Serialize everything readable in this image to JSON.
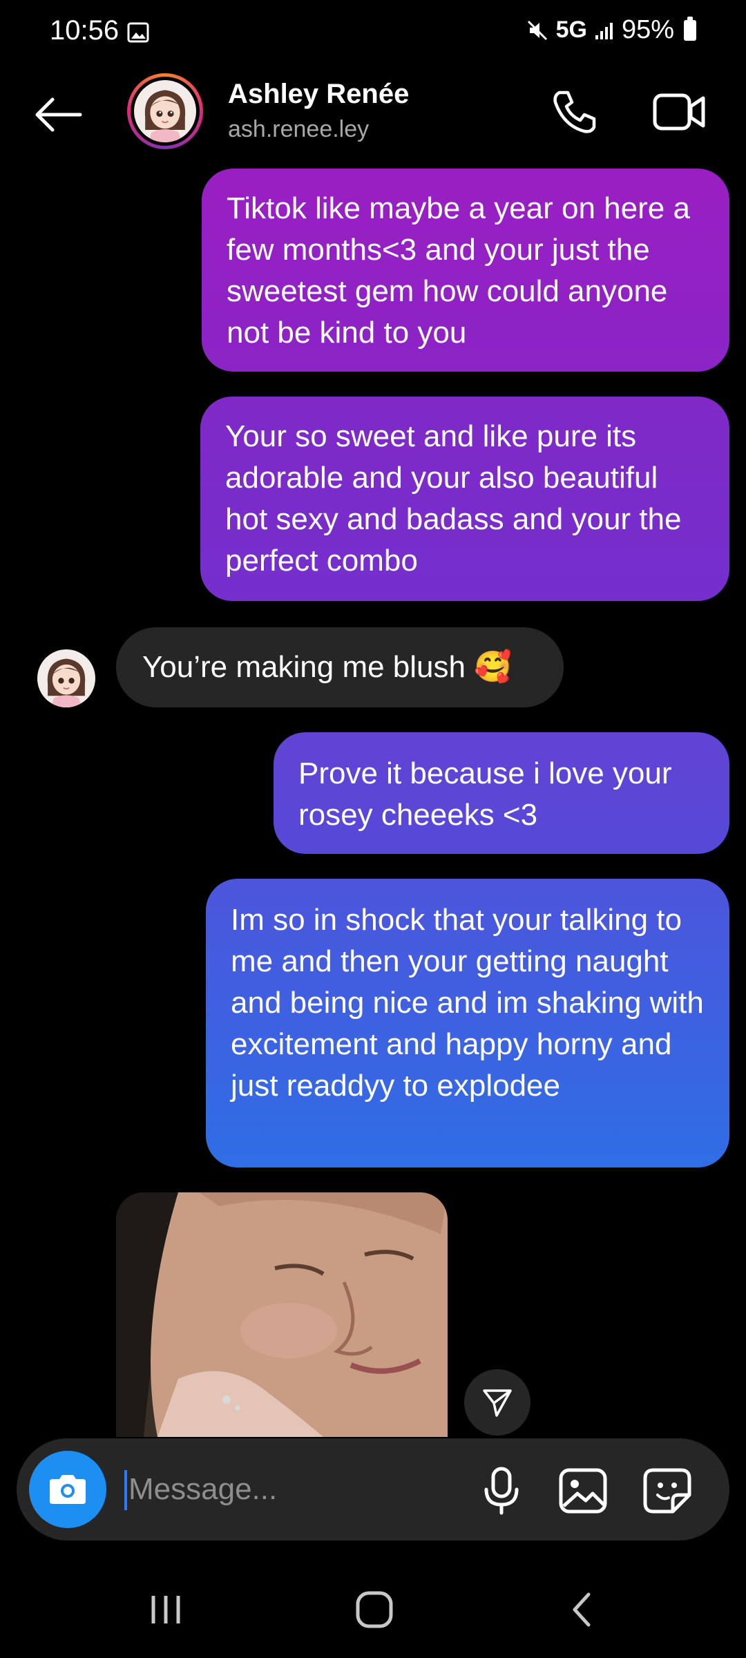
{
  "status_bar": {
    "time": "10:56",
    "network": "5G",
    "battery": "95%",
    "icons": [
      "gallery-icon",
      "mute-icon",
      "signal-icon",
      "battery-icon"
    ]
  },
  "header": {
    "contact_name": "Ashley Renée",
    "username": "ash.renee.ley",
    "icons": [
      "back-arrow-icon",
      "phone-icon",
      "video-camera-icon"
    ]
  },
  "messages": [
    {
      "direction": "sent",
      "text": "Tiktok like maybe a year on here a few months<3 and your just the sweetest gem how could anyone not be kind to you"
    },
    {
      "direction": "sent",
      "text": "Your so sweet and like pure its adorable and your also beautiful hot sexy and badass and your the perfect combo"
    },
    {
      "direction": "received",
      "text": "You’re making me blush 🥰"
    },
    {
      "direction": "sent",
      "text": "Prove it because i love your rosey cheeeks <3"
    },
    {
      "direction": "sent",
      "text": "Im so in shock that your talking to me and then your getting naught and being nice and im shaking with excitement and happy horny and just readdyy to explodee"
    },
    {
      "direction": "received",
      "type": "photo"
    }
  ],
  "composer": {
    "placeholder": "Message...",
    "value": "",
    "icons": [
      "camera-icon",
      "microphone-icon",
      "image-icon",
      "sticker-icon"
    ]
  },
  "nav_bar": {
    "icons": [
      "recent-apps-icon",
      "home-icon",
      "back-icon"
    ]
  },
  "colors": {
    "background": "#000000",
    "received_bubble": "#262626",
    "camera_button": "#1d8ff2",
    "sent_gradient_top": "#9a1fc2",
    "sent_gradient_bottom": "#2f6ee6",
    "username": "#a8a8a8"
  }
}
